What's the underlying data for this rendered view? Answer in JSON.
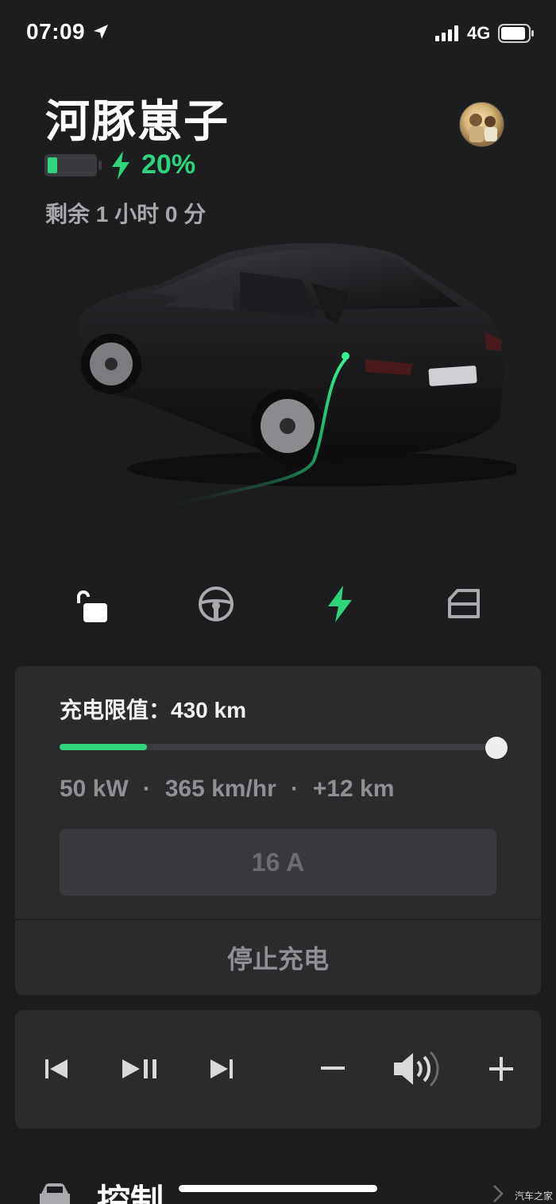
{
  "status": {
    "time": "07:09",
    "network": "4G",
    "icons": [
      "location-arrow-icon",
      "signal-icon",
      "battery-icon"
    ]
  },
  "vehicle": {
    "name": "河豚崽子",
    "battery_percent_label": "20%",
    "battery_level": 0.2,
    "remaining": "剩余 1 小时 0 分"
  },
  "quick_actions": [
    {
      "icon": "unlock-icon"
    },
    {
      "icon": "steering-wheel-icon"
    },
    {
      "icon": "charging-bolt-icon"
    },
    {
      "icon": "frunk-icon"
    }
  ],
  "charging": {
    "limit_label": "充电限值：",
    "limit_value": "430 km",
    "progress_fraction": 0.2,
    "stat_power": "50 kW",
    "stat_rate": "365 km/hr",
    "stat_added": "+12 km",
    "separator": "·",
    "amps": "16 A",
    "stop_label": "停止充电"
  },
  "media": {
    "icons": [
      "previous-track-icon",
      "play-pause-icon",
      "next-track-icon",
      "volume-down-icon",
      "volume-icon",
      "volume-up-icon"
    ]
  },
  "bottom": {
    "section_title": "控制",
    "watermark": "汽车之家"
  },
  "colors": {
    "accent_green": "#2fd47a",
    "background": "#1c1d1f",
    "card": "#2a2b2d"
  }
}
